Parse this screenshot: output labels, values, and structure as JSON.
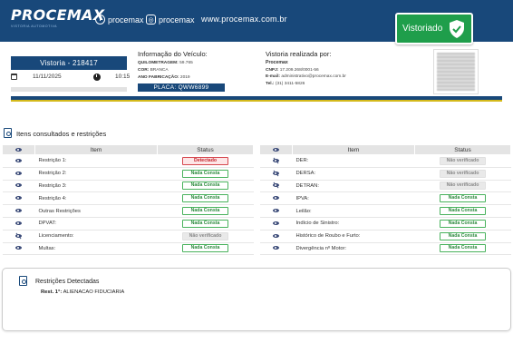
{
  "header": {
    "logo": "PROCEMAX",
    "logo_tagline": "VISTORIA AUTOMOTIVA",
    "facebook": "procemax",
    "instagram": "procemax",
    "website": "www.procemax.com.br",
    "badge": "Vistoriado"
  },
  "vistoria": {
    "title": "Vistoria - 218417",
    "date": "11/11/2025",
    "time": "10:15"
  },
  "vehicle": {
    "section_title": "Informação do Veículo:",
    "mileage_label": "QUILOMETRAGEM:",
    "mileage": "59.765",
    "color_label": "COR:",
    "color": "BRANCA",
    "year_label": "ANO FABRICAÇÃO:",
    "year": "2019",
    "plate_label": "PLACA:",
    "plate": "QWW6899"
  },
  "performed_by": {
    "section_title": "Vistoria realizada por:",
    "name": "Procemax",
    "cnpj_label": "CNPJ:",
    "cnpj": "17.209.268/0001-56",
    "email_label": "E-mail:",
    "email": "administrativo@procemax.com.br",
    "phone_label": "Tel.:",
    "phone": "(31) 3411-5826"
  },
  "items_section": {
    "title": "Itens consultados e restrições",
    "col_item": "Item",
    "col_status": "Status",
    "left_rows": [
      {
        "item": "Restrição 1:",
        "status": "Detectado",
        "kind": "bad",
        "eye": "open"
      },
      {
        "item": "Restrição 2:",
        "status": "Nada Consta",
        "kind": "ok",
        "eye": "open"
      },
      {
        "item": "Restrição 3:",
        "status": "Nada Consta",
        "kind": "ok",
        "eye": "open"
      },
      {
        "item": "Restrição 4:",
        "status": "Nada Consta",
        "kind": "ok",
        "eye": "open"
      },
      {
        "item": "Outras Restrições",
        "status": "Nada Consta",
        "kind": "ok",
        "eye": "open"
      },
      {
        "item": "DPVAT:",
        "status": "Nada Consta",
        "kind": "ok",
        "eye": "open"
      },
      {
        "item": "Licenciamento:",
        "status": "Não verificado",
        "kind": "nv",
        "eye": "slash"
      },
      {
        "item": "Multas:",
        "status": "Nada Consta",
        "kind": "ok",
        "eye": "open"
      }
    ],
    "right_rows": [
      {
        "item": "DER:",
        "status": "Não verificado",
        "kind": "nv",
        "eye": "slash"
      },
      {
        "item": "DERSA:",
        "status": "Não verificado",
        "kind": "nv",
        "eye": "slash"
      },
      {
        "item": "DETRAN:",
        "status": "Não verificado",
        "kind": "nv",
        "eye": "slash"
      },
      {
        "item": "IPVA:",
        "status": "Nada Consta",
        "kind": "ok",
        "eye": "open"
      },
      {
        "item": "Leilão:",
        "status": "Nada Consta",
        "kind": "ok",
        "eye": "open"
      },
      {
        "item": "Indício de Sinistro:",
        "status": "Nada Consta",
        "kind": "ok",
        "eye": "open"
      },
      {
        "item": "Histórico de Roubo e Furto:",
        "status": "Nada Consta",
        "kind": "ok",
        "eye": "open"
      },
      {
        "item": "Divergência nº Motor:",
        "status": "Nada Consta",
        "kind": "ok",
        "eye": "open"
      }
    ]
  },
  "restrictions": {
    "title": "Restrições Detectadas",
    "label": "Rest. 1°:",
    "value": "ALIENACAO FIDUCIARIA"
  },
  "colors": {
    "brand_blue": "#18487a",
    "accent_yellow": "#d4b91a",
    "badge_green": "#1f9e4b",
    "ok_green": "#2d8a3e",
    "bad_red": "#c4262e"
  }
}
